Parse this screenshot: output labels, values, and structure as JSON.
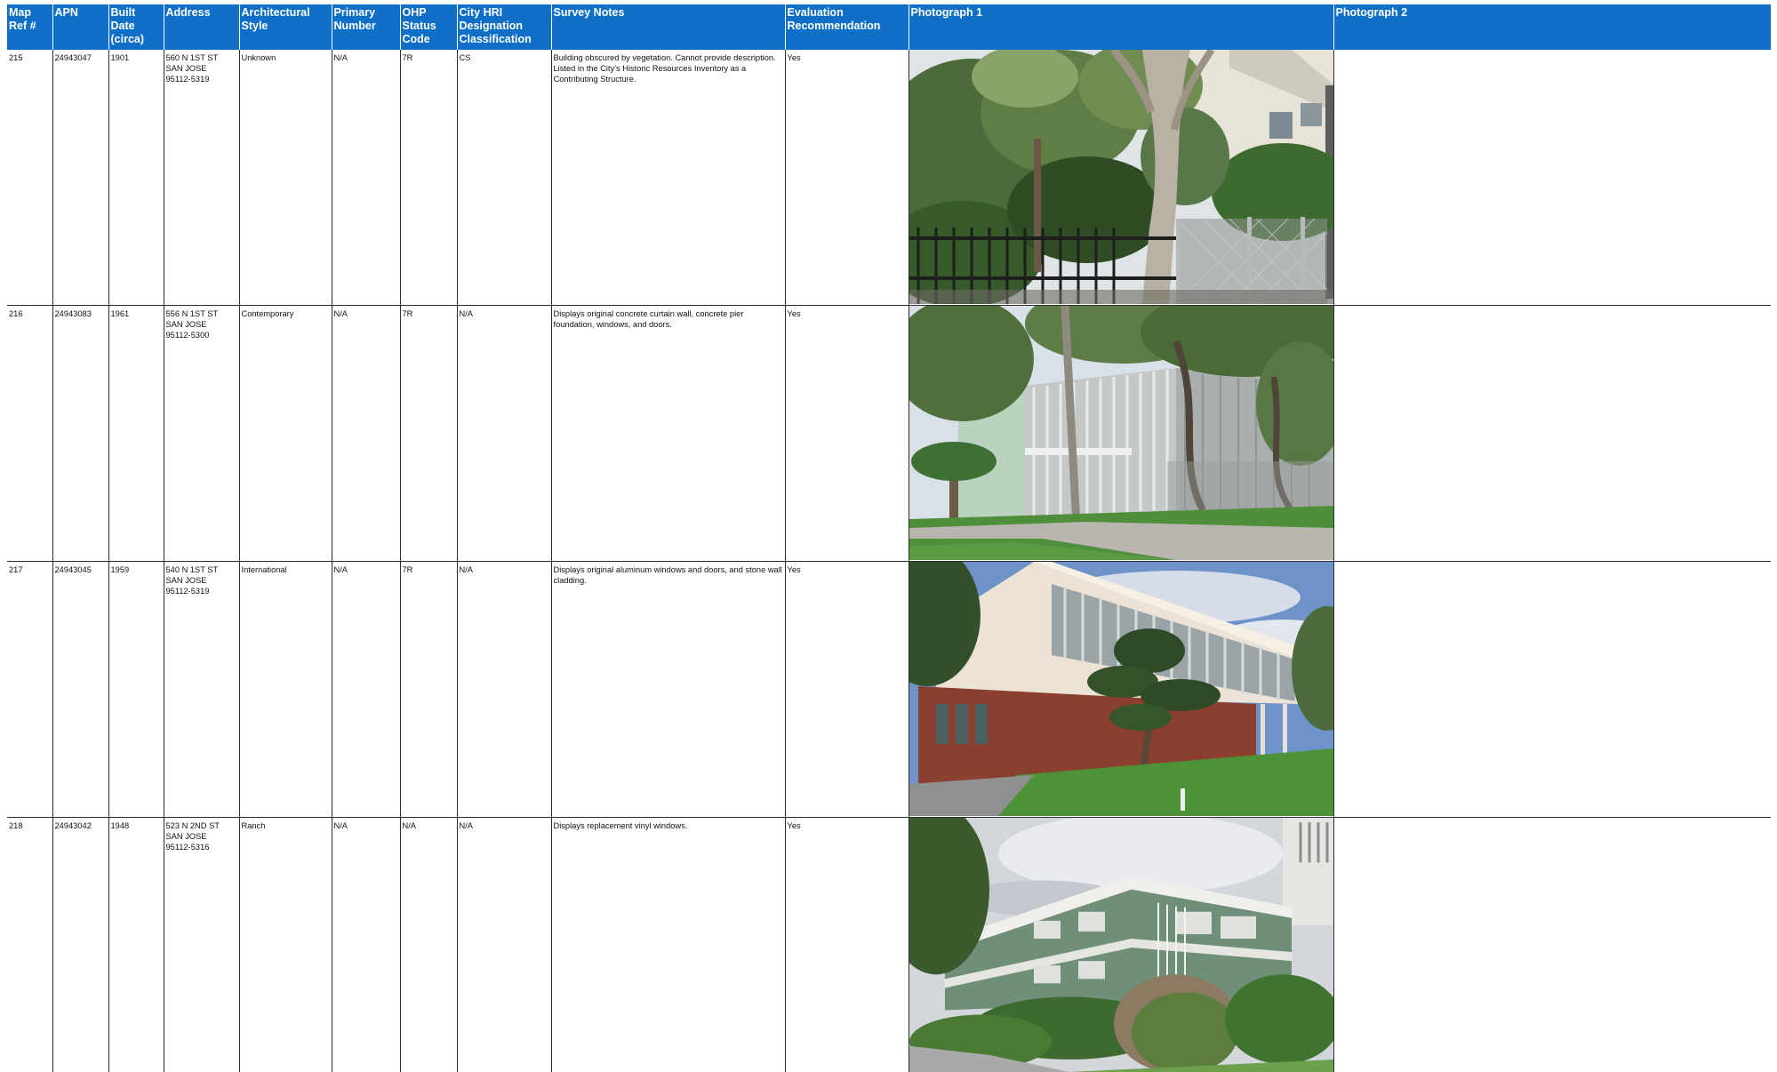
{
  "headers": {
    "map_ref": "Map Ref #",
    "apn": "APN",
    "built_date": "Built Date (circa)",
    "address": "Address",
    "arch_style": "Architectural Style",
    "primary_number": "Primary Number",
    "ohp_status": "OHP Status Code",
    "city_hri": "City HRI Designation Classification",
    "survey_notes": "Survey Notes",
    "evaluation": "Evaluation Recommendation",
    "photo1": "Photograph 1",
    "photo2": "Photograph 2"
  },
  "rows": [
    {
      "map_ref": "215",
      "apn": "24943047",
      "built_date": "1901",
      "address": [
        "560 N 1ST ST",
        "SAN JOSE",
        "95112-5319"
      ],
      "arch_style": "Unknown",
      "primary_number": "N/A",
      "ohp_status": "7R",
      "city_hri": "CS",
      "survey_notes": "Building obscured by vegetation. Cannot provide description. Listed in the City's Historic Resources Inventory as a Contributing Structure.",
      "evaluation": "Yes"
    },
    {
      "map_ref": "216",
      "apn": "24943083",
      "built_date": "1961",
      "address": [
        "556 N 1ST ST",
        "SAN JOSE",
        "95112-5300"
      ],
      "arch_style": "Contemporary",
      "primary_number": "N/A",
      "ohp_status": "7R",
      "city_hri": "N/A",
      "survey_notes": "Displays original concrete curtain wall, concrete pier foundation, windows, and doors.",
      "evaluation": "Yes"
    },
    {
      "map_ref": "217",
      "apn": "24943045",
      "built_date": "1959",
      "address": [
        "540 N 1ST ST",
        "SAN JOSE",
        "95112-5319"
      ],
      "arch_style": "International",
      "primary_number": "N/A",
      "ohp_status": "7R",
      "city_hri": "N/A",
      "survey_notes": "Displays original aluminum windows and doors, and stone wall cladding.",
      "evaluation": "Yes"
    },
    {
      "map_ref": "218",
      "apn": "24943042",
      "built_date": "1948",
      "address": [
        "523 N 2ND ST",
        "SAN JOSE",
        "95112-5316"
      ],
      "arch_style": "Ranch",
      "primary_number": "N/A",
      "ohp_status": "N/A",
      "city_hri": "N/A",
      "survey_notes": "Displays replacement vinyl windows.",
      "evaluation": "Yes"
    }
  ],
  "colors": {
    "header_bg": "#0f6fc6",
    "header_text": "#ffffff",
    "grid": "#2b2b2b"
  }
}
